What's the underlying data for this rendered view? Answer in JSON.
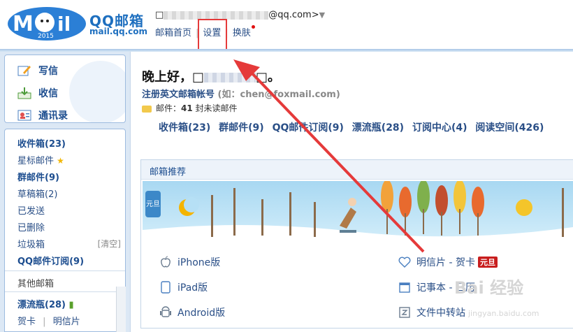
{
  "brand": {
    "name": "QQ邮箱",
    "domain": "mail.qq.com",
    "year": "2015"
  },
  "account": {
    "prefix": "□",
    "suffix": "@qq.com>",
    "dropdown_icon": "triangle-down"
  },
  "topnav": [
    {
      "label": "邮箱首页"
    },
    {
      "label": "设置"
    },
    {
      "label": "换肤"
    }
  ],
  "sidebar": {
    "main_buttons": {
      "compose": "写信",
      "inbox": "收信",
      "contacts": "通讯录"
    },
    "folders": {
      "inbox": "收件箱(23)",
      "starred": "星标邮件",
      "group": "群邮件(9)",
      "drafts": "草稿箱(2)",
      "sent": "已发送",
      "deleted": "已删除",
      "spam": "垃圾箱",
      "spam_clear": "[清空]",
      "subscriptions": "QQ邮件订阅(9)",
      "other": "其他邮箱",
      "drift": "漂流瓶(28)",
      "cards": "贺卡",
      "cards_sep": "|",
      "postcards": "明信片"
    }
  },
  "main": {
    "greeting_start": "晚上好，□",
    "greeting_end": "□。",
    "register_label": "注册英文邮箱帐号",
    "register_hint": "(如：chen@foxmail.com)",
    "unread_label": "邮件：",
    "unread_count": "41",
    "unread_suffix": " 封未读邮件",
    "shortcuts": [
      "收件箱(23)",
      "群邮件(9)",
      "QQ邮件订阅(9)",
      "漂流瓶(28)",
      "订阅中心(4)",
      "阅读空间(426)"
    ],
    "recommend": {
      "title": "邮箱推荐",
      "banner_label": "元旦",
      "items": {
        "iphone": "iPhone版",
        "ipad": "iPad版",
        "android": "Android版",
        "postcard": "明信片 - 贺卡",
        "postcard_badge": "元旦",
        "notepad": "记事本 - 日历",
        "transfer": "文件中转站"
      }
    }
  },
  "watermark": {
    "main": "Bai 经验",
    "sub": "jingyan.baidu.com"
  },
  "colors": {
    "link": "#2a4f87",
    "highlight": "#e53a3a",
    "accent": "#1e6fbf"
  }
}
